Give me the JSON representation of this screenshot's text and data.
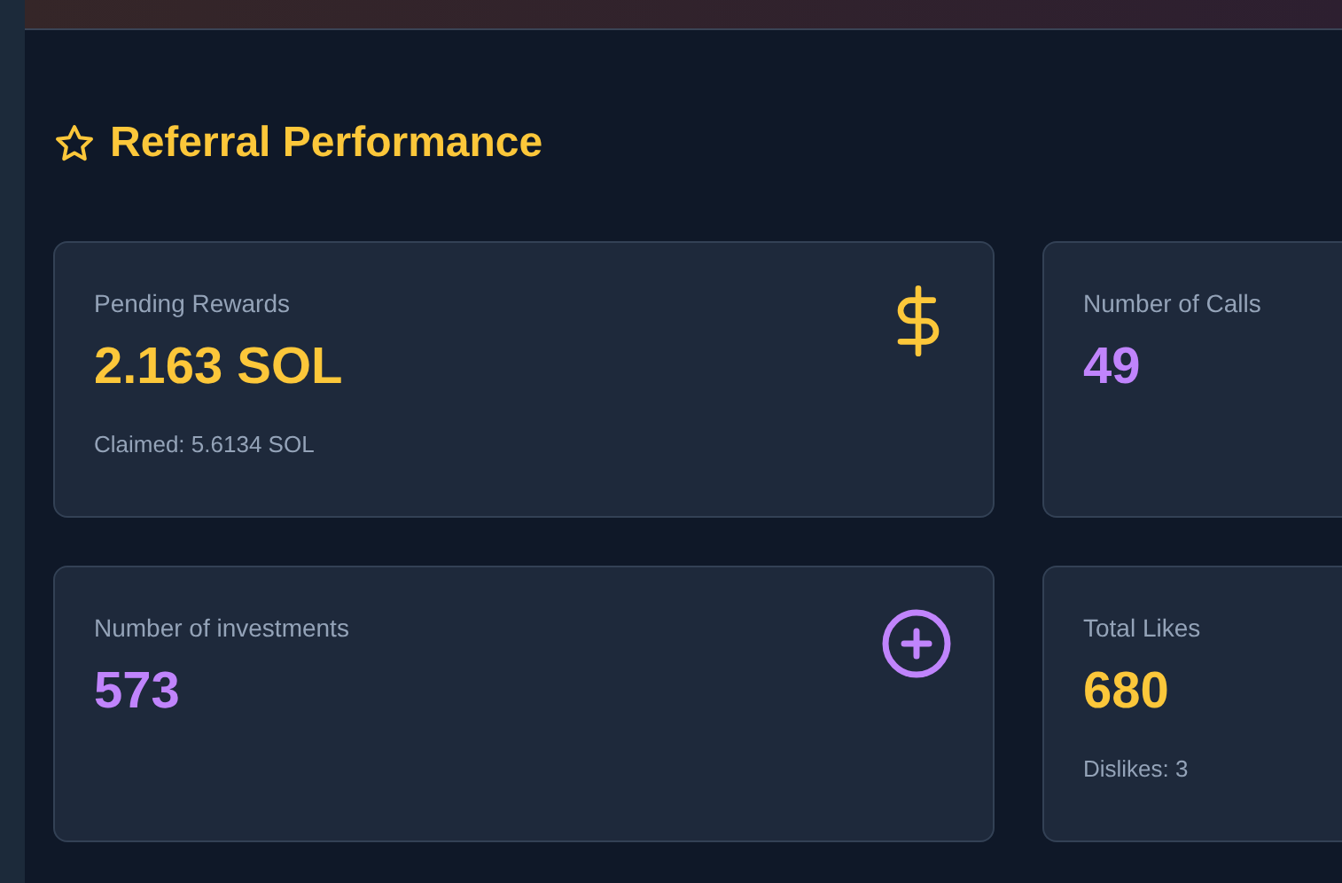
{
  "section": {
    "title": "Referral Performance"
  },
  "cards": [
    {
      "label": "Pending Rewards",
      "value": "2.163 SOL",
      "color": "#fcc73a",
      "note": "Claimed: 5.6134 SOL",
      "kind": "money"
    },
    {
      "label": "Number of Calls",
      "value": "49",
      "color": "#c084fc",
      "kind": "plain"
    },
    {
      "label": "Number of investments",
      "value": "573",
      "color": "#c084fc",
      "kind": "add"
    },
    {
      "label": "Total Likes",
      "value": "680",
      "color": "#fcc73a",
      "note": "Dislikes: 3",
      "kind": "plain"
    }
  ]
}
